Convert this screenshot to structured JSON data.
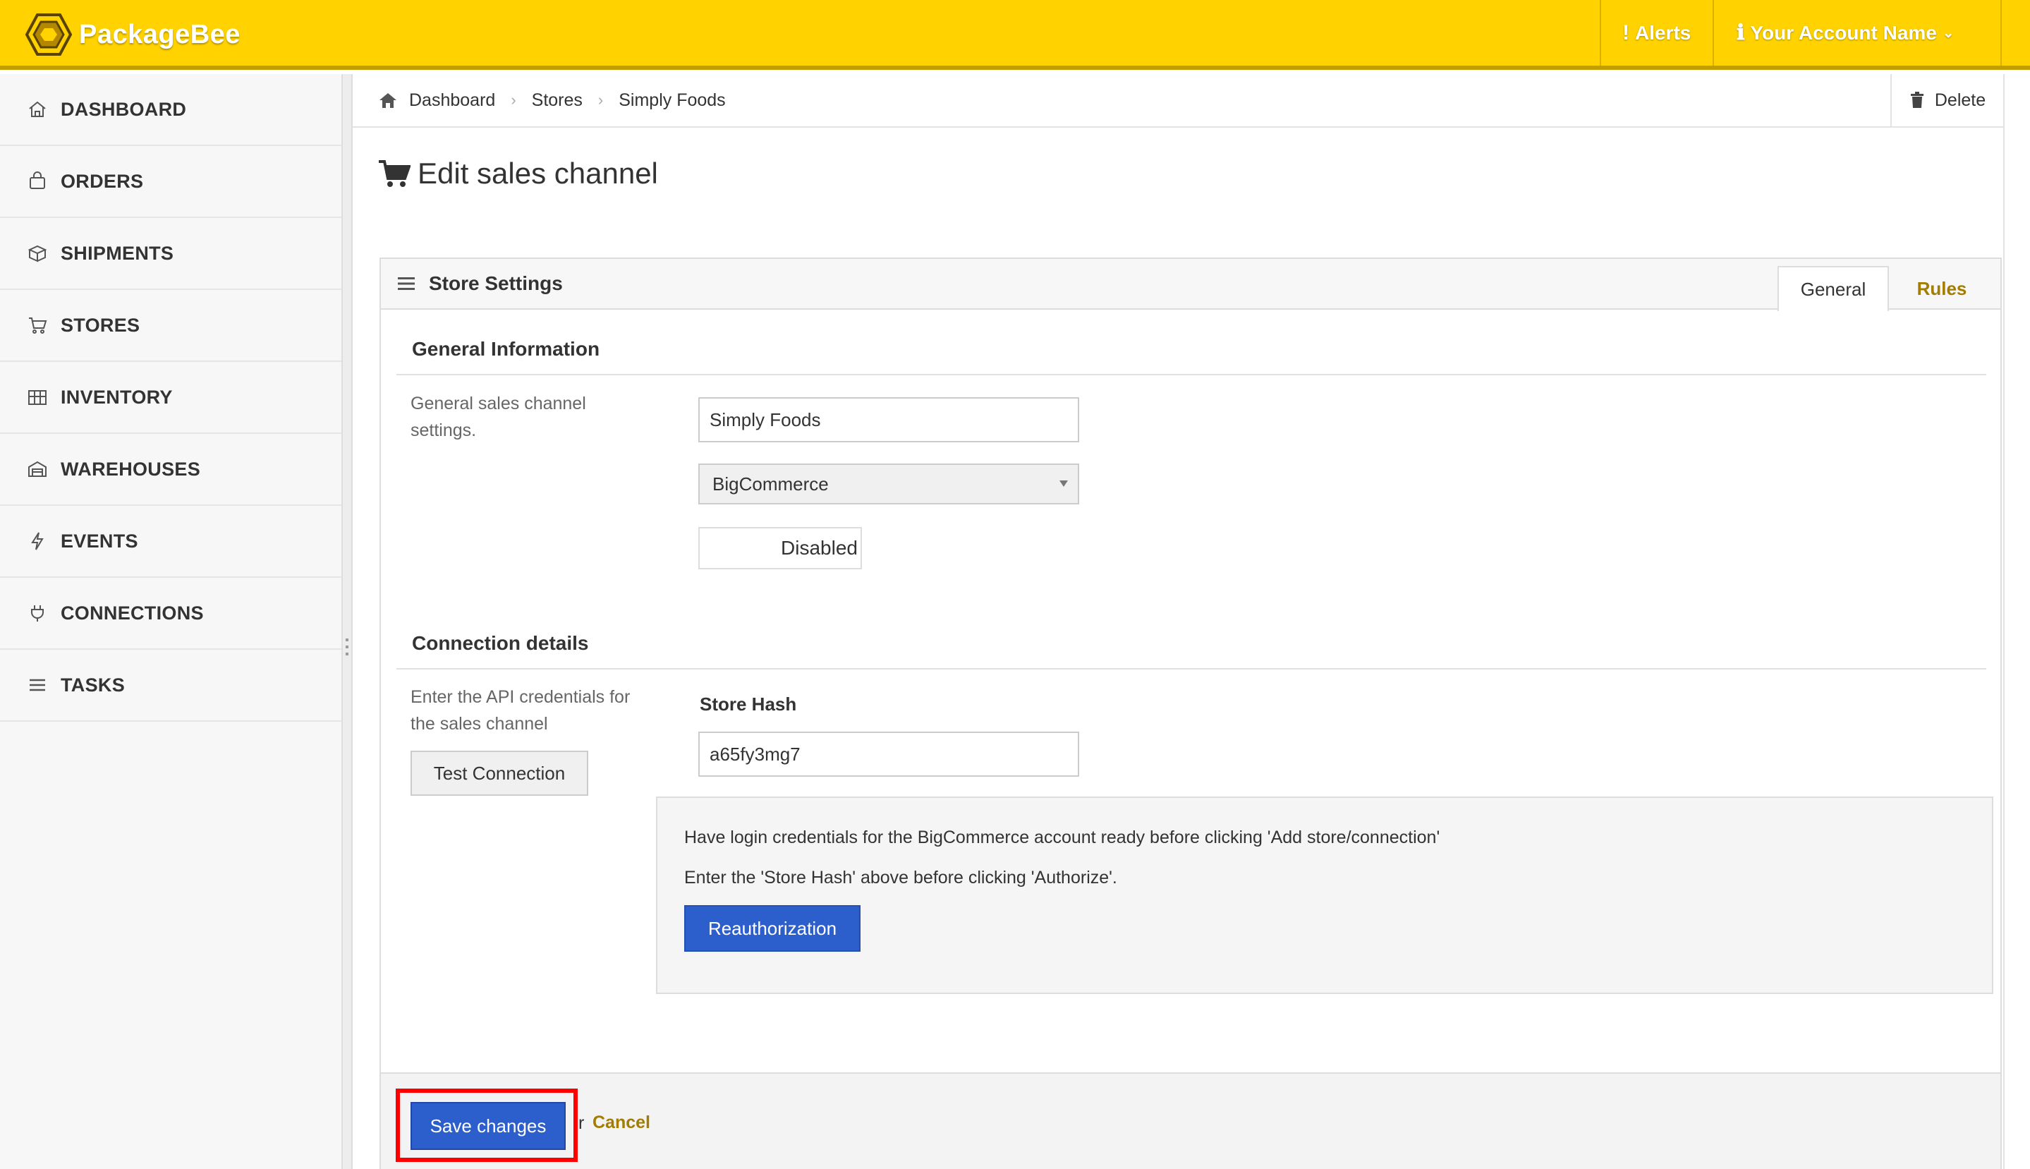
{
  "brand": {
    "name": "PackageBee",
    "color": "#ffd200"
  },
  "header": {
    "alerts_label": "Alerts",
    "account_label": "Your Account Name"
  },
  "sidebar": {
    "items": [
      {
        "label": "DASHBOARD",
        "icon": "home-icon"
      },
      {
        "label": "ORDERS",
        "icon": "shopping-bag-icon"
      },
      {
        "label": "SHIPMENTS",
        "icon": "package-icon"
      },
      {
        "label": "STORES",
        "icon": "cart-icon"
      },
      {
        "label": "INVENTORY",
        "icon": "inventory-icon"
      },
      {
        "label": "WAREHOUSES",
        "icon": "warehouse-icon"
      },
      {
        "label": "EVENTS",
        "icon": "lightning-icon"
      },
      {
        "label": "CONNECTIONS",
        "icon": "plug-icon"
      },
      {
        "label": "TASKS",
        "icon": "list-icon"
      }
    ]
  },
  "breadcrumb": {
    "items": [
      "Dashboard",
      "Stores",
      "Simply Foods"
    ]
  },
  "toolbar": {
    "delete_label": "Delete"
  },
  "page": {
    "title": "Edit sales channel"
  },
  "panel": {
    "title": "Store Settings",
    "tabs": [
      {
        "label": "General",
        "active": true
      },
      {
        "label": "Rules",
        "active": false
      }
    ]
  },
  "general_info": {
    "heading": "General Information",
    "help": "General sales channel settings.",
    "name_value": "Simply Foods",
    "platform_value": "BigCommerce",
    "status_value": "Disabled"
  },
  "connection": {
    "heading": "Connection details",
    "help": "Enter the API credentials for the sales channel",
    "test_button": "Test Connection",
    "store_hash_label": "Store Hash",
    "store_hash_value": "a65fy3mg7",
    "info_line_1": "Have login credentials for the BigCommerce account ready before clicking 'Add store/connection'",
    "info_line_2": "Enter the 'Store Hash' above before clicking 'Authorize'.",
    "reauth_button": "Reauthorization"
  },
  "footer": {
    "save_label": "Save changes",
    "or_text": "r",
    "cancel_label": "Cancel"
  },
  "colors": {
    "primary": "#2d5fcc",
    "link": "#a37d00",
    "highlight": "#ff0000"
  }
}
